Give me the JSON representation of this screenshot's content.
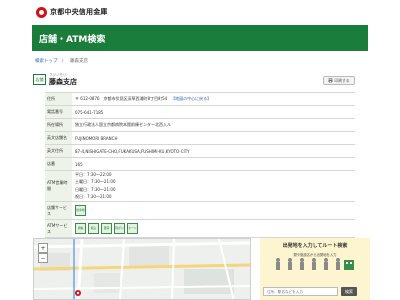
{
  "header": {
    "brand_name": "京都中央信用金庫",
    "page_title": "店舗・ATM検索"
  },
  "breadcrumb": {
    "items": [
      "検索トップ",
      "〉",
      "藤森支店"
    ]
  },
  "store": {
    "badge": "店舗",
    "ruby": "フジノモリ",
    "name": "藤森支店",
    "print_label": "印刷する"
  },
  "info": {
    "rows": [
      {
        "label": "住所",
        "value": "〒 612-0876　京都市伏見区深草西浦町8丁目町54",
        "link": "【地図の中心に戻る】"
      },
      {
        "label": "電話番号",
        "value": "075-641-7185"
      },
      {
        "label": "所在場所",
        "value": "独立行政法人国立京都病院本館前棟センター北西入ル"
      },
      {
        "label": "英文店舗名",
        "value": "FUJINOMORI BRANCH"
      },
      {
        "label": "英文住所",
        "value": "87-4,NISHIGATE-CHO,FUKAKUSA,FUSHIMI-KU,KYOTO-CITY"
      },
      {
        "label": "店番",
        "value": "165"
      }
    ],
    "atm_hours_label": "ATM営業時間",
    "atm_hours": [
      "平日：7:30～22:00",
      "土曜日：7:30～21:00",
      "日曜日：7:30～21:00",
      "祝日：7:30～21:00"
    ],
    "store_service_label": "店舗サービス",
    "store_services": [
      "駐車場"
    ],
    "atm_service_label": "ATMサービス",
    "atm_services": [
      "通帳",
      "振込",
      "硬貨",
      "障がい",
      "カード"
    ]
  },
  "route": {
    "title": "出発地を入力してルート検索",
    "subtitle": "駅や施設名から出発地を入力",
    "input_placeholder": "住所、駅名などを入力",
    "button_label": "検索"
  },
  "colors": {
    "brand_green": "#1a7d3b",
    "brand_red": "#d0101b",
    "route_bg": "#fdf5cf"
  }
}
